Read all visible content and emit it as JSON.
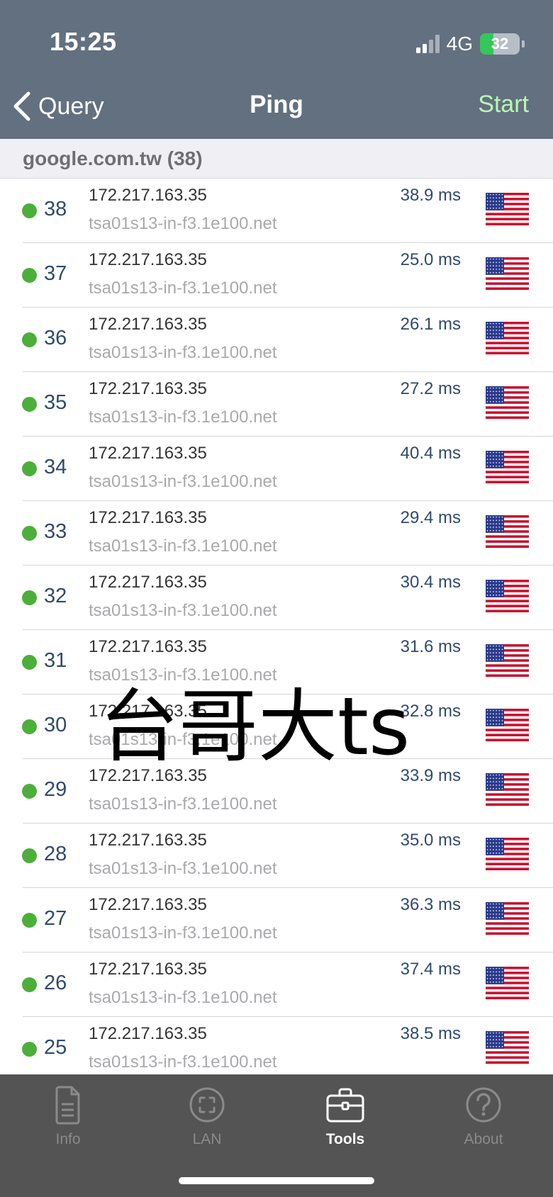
{
  "status_bar": {
    "time": "15:25",
    "network": "4G",
    "battery": "32"
  },
  "nav": {
    "back_label": "Query",
    "title": "Ping",
    "action_label": "Start"
  },
  "section": {
    "title": "google.com.tw (38)"
  },
  "rows": [
    {
      "seq": "38",
      "ip": "172.217.163.35",
      "host": "tsa01s13-in-f3.1e100.net",
      "time": "38.9 ms"
    },
    {
      "seq": "37",
      "ip": "172.217.163.35",
      "host": "tsa01s13-in-f3.1e100.net",
      "time": "25.0 ms"
    },
    {
      "seq": "36",
      "ip": "172.217.163.35",
      "host": "tsa01s13-in-f3.1e100.net",
      "time": "26.1 ms"
    },
    {
      "seq": "35",
      "ip": "172.217.163.35",
      "host": "tsa01s13-in-f3.1e100.net",
      "time": "27.2 ms"
    },
    {
      "seq": "34",
      "ip": "172.217.163.35",
      "host": "tsa01s13-in-f3.1e100.net",
      "time": "40.4 ms"
    },
    {
      "seq": "33",
      "ip": "172.217.163.35",
      "host": "tsa01s13-in-f3.1e100.net",
      "time": "29.4 ms"
    },
    {
      "seq": "32",
      "ip": "172.217.163.35",
      "host": "tsa01s13-in-f3.1e100.net",
      "time": "30.4 ms"
    },
    {
      "seq": "31",
      "ip": "172.217.163.35",
      "host": "tsa01s13-in-f3.1e100.net",
      "time": "31.6 ms"
    },
    {
      "seq": "30",
      "ip": "172.217.163.35",
      "host": "tsa01s13-in-f3.1e100.net",
      "time": "32.8 ms"
    },
    {
      "seq": "29",
      "ip": "172.217.163.35",
      "host": "tsa01s13-in-f3.1e100.net",
      "time": "33.9 ms"
    },
    {
      "seq": "28",
      "ip": "172.217.163.35",
      "host": "tsa01s13-in-f3.1e100.net",
      "time": "35.0 ms"
    },
    {
      "seq": "27",
      "ip": "172.217.163.35",
      "host": "tsa01s13-in-f3.1e100.net",
      "time": "36.3 ms"
    },
    {
      "seq": "26",
      "ip": "172.217.163.35",
      "host": "tsa01s13-in-f3.1e100.net",
      "time": "37.4 ms"
    },
    {
      "seq": "25",
      "ip": "172.217.163.35",
      "host": "tsa01s13-in-f3.1e100.net",
      "time": "38.5 ms"
    }
  ],
  "row_icons": {
    "status": "status-dot-icon",
    "flag": "us-flag-icon"
  },
  "watermark": "台哥大ts",
  "tabs": [
    {
      "label": "Info",
      "icon": "document-icon",
      "active": false
    },
    {
      "label": "LAN",
      "icon": "lan-scan-icon",
      "active": false
    },
    {
      "label": "Tools",
      "icon": "toolbox-icon",
      "active": true
    },
    {
      "label": "About",
      "icon": "question-icon",
      "active": false
    }
  ],
  "colors": {
    "header_bg": "#627080",
    "start_green": "#b9f7b0",
    "status_dot": "#4caf3a",
    "seq_blue": "#2f4a6e",
    "tabbar_bg": "#545454"
  }
}
